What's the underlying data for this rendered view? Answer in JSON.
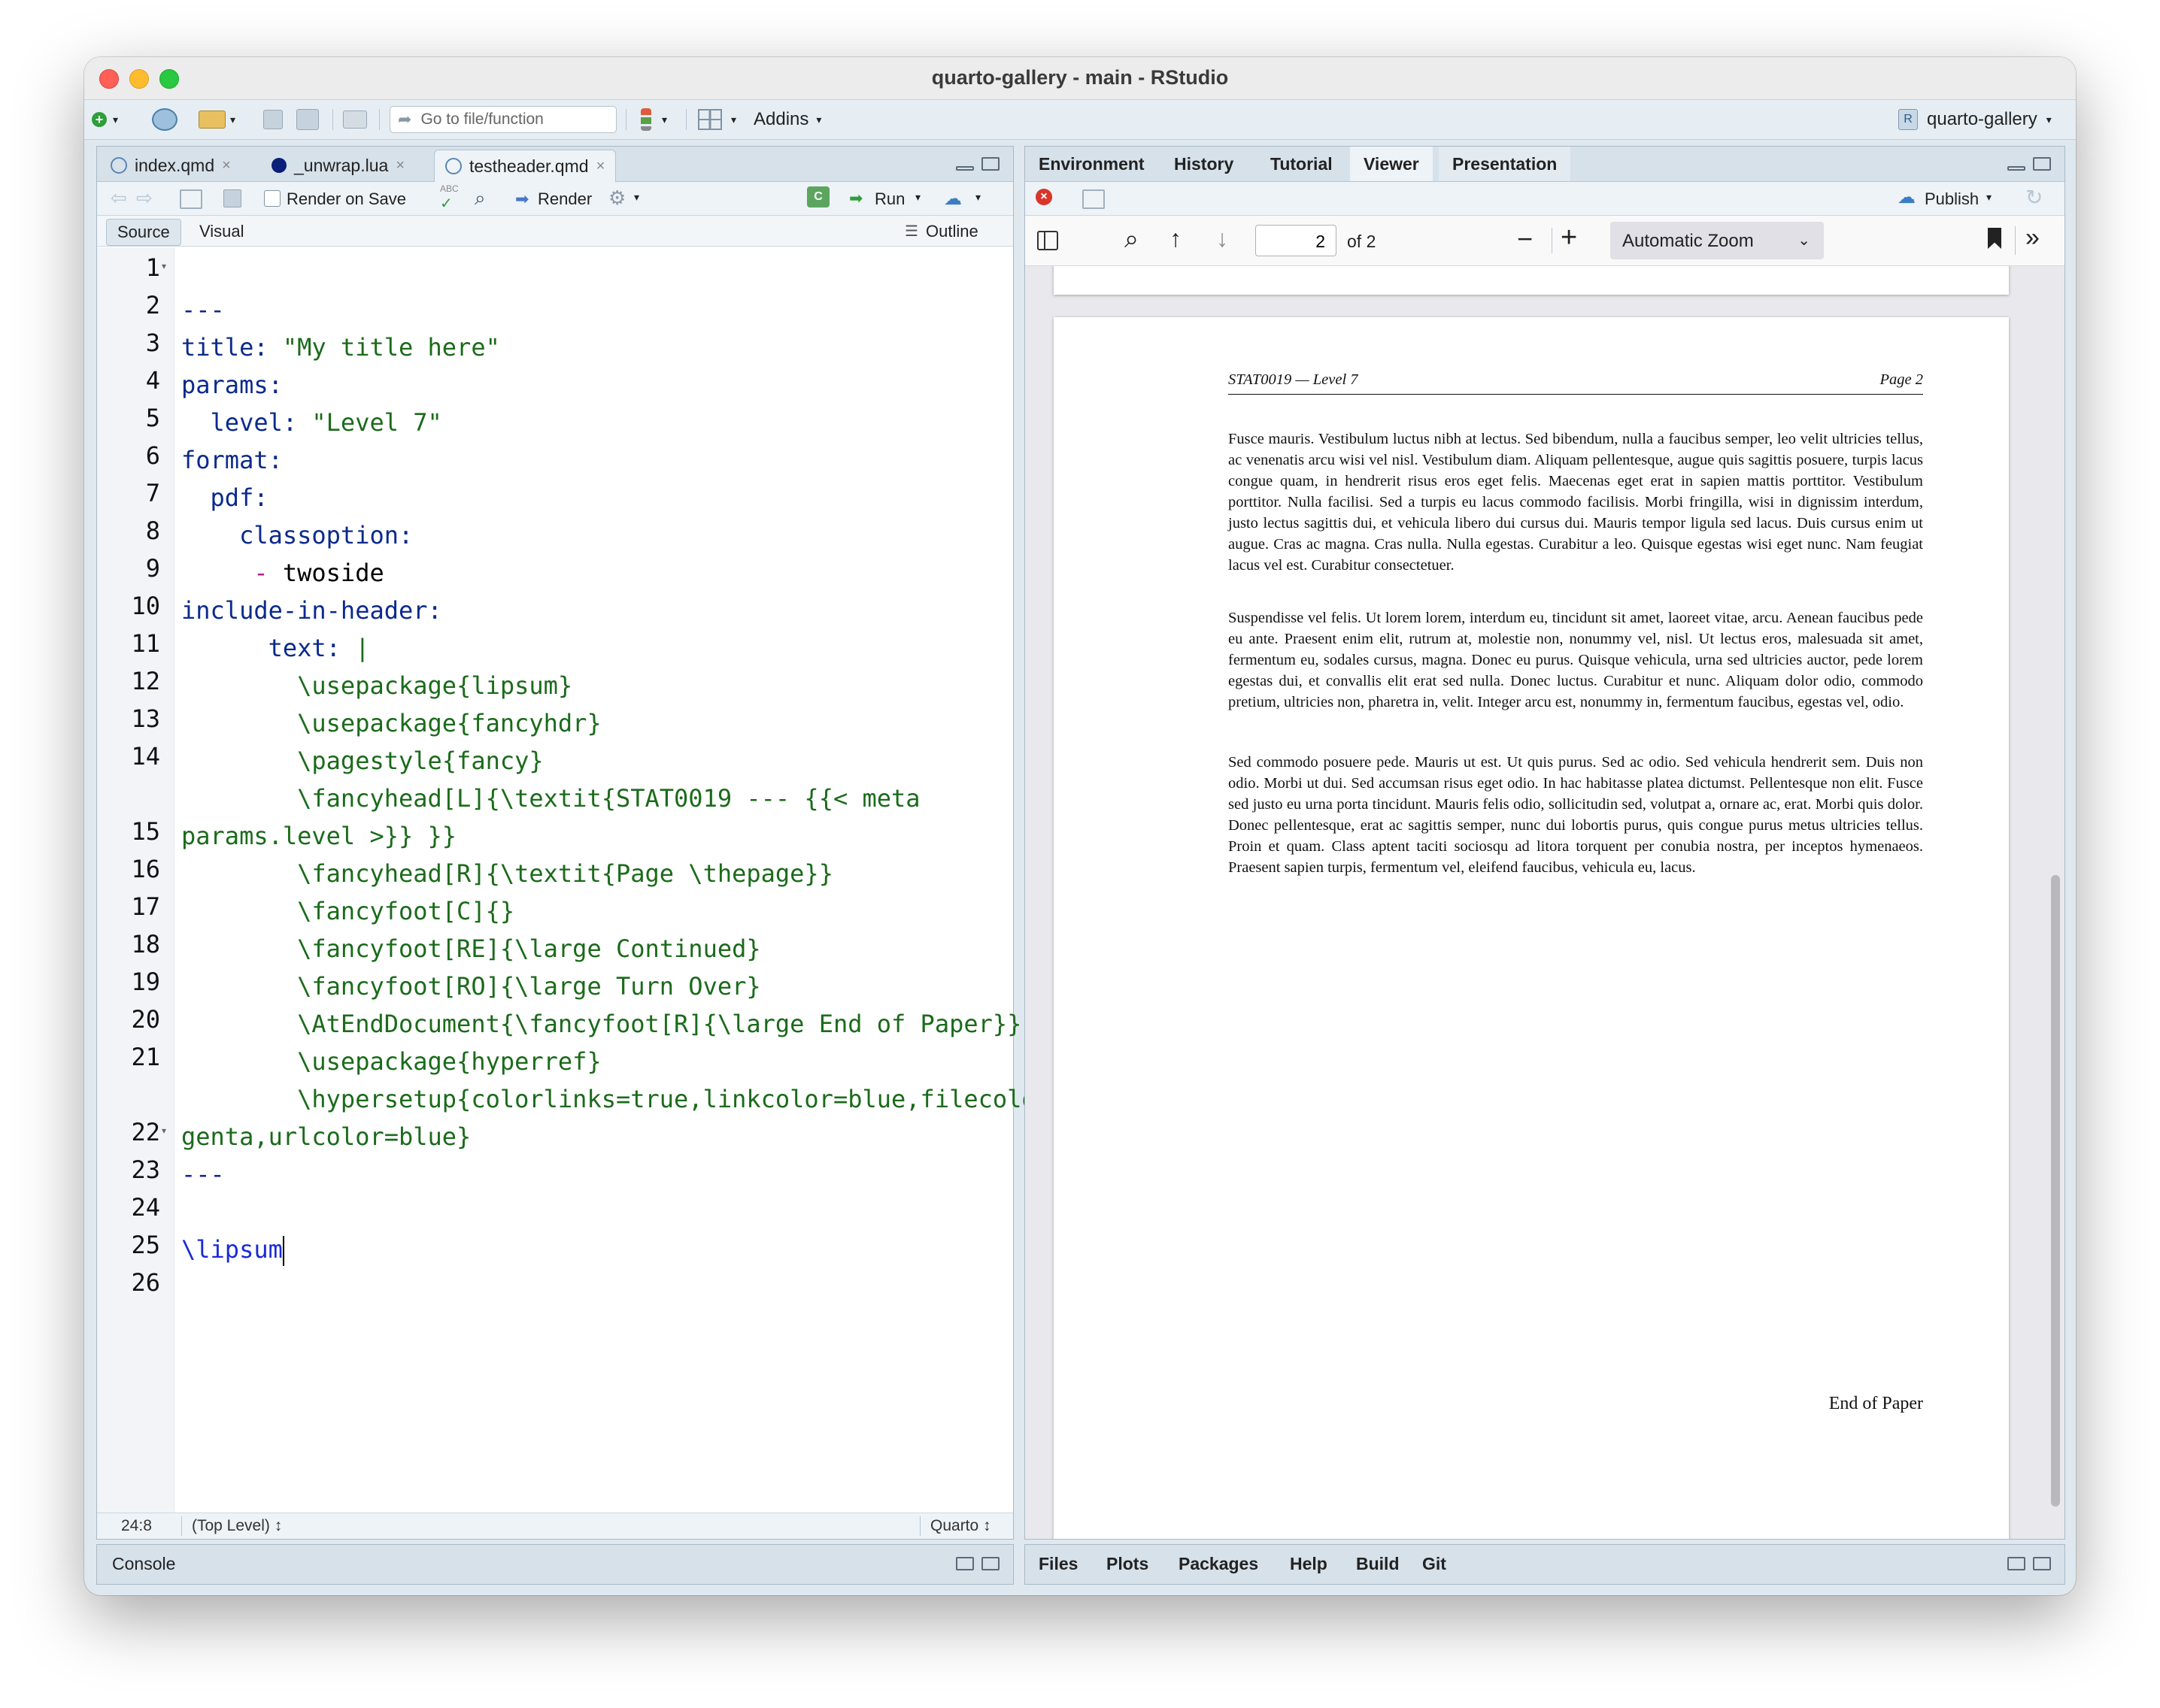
{
  "window": {
    "title": "quarto-gallery - main - RStudio"
  },
  "toolbar": {
    "goto_placeholder": "Go to file/function",
    "addins_label": "Addins",
    "project_label": "quarto-gallery"
  },
  "editor": {
    "tabs": [
      {
        "label": "index.qmd"
      },
      {
        "label": "_unwrap.lua"
      },
      {
        "label": "testheader.qmd"
      }
    ],
    "render_on_save_label": "Render on Save",
    "render_label": "Render",
    "run_label": "Run",
    "source_label": "Source",
    "visual_label": "Visual",
    "outline_label": "Outline",
    "line_numbers": [
      "1",
      "2",
      "3",
      "4",
      "5",
      "6",
      "7",
      "8",
      "9",
      "10",
      "11",
      "12",
      "13",
      "14",
      "15",
      "16",
      "17",
      "18",
      "19",
      "20",
      "21",
      "22",
      "23",
      "24",
      "25",
      "26"
    ],
    "status": {
      "position": "24:8",
      "scope": "(Top Level) ↕",
      "mode": "Quarto ↕"
    }
  },
  "console": {
    "label": "Console"
  },
  "viewer": {
    "tabs": [
      {
        "label": "Environment"
      },
      {
        "label": "History"
      },
      {
        "label": "Tutorial"
      },
      {
        "label": "Viewer"
      },
      {
        "label": "Presentation"
      }
    ],
    "publish_label": "Publish",
    "page_number": "2",
    "page_total": "of 2",
    "zoom_label": "Automatic Zoom",
    "pdf": {
      "header_left": "STAT0019 — Level 7",
      "header_right": "Page 2",
      "paragraphs": [
        "Fusce mauris. Vestibulum luctus nibh at lectus. Sed bibendum, nulla a faucibus semper, leo velit ultricies tellus, ac venenatis arcu wisi vel nisl. Vestibulum diam. Aliquam pellentesque, augue quis sagittis posuere, turpis lacus congue quam, in hendrerit risus eros eget felis. Maecenas eget erat in sapien mattis porttitor. Vestibulum porttitor. Nulla facilisi. Sed a turpis eu lacus commodo facilisis. Morbi fringilla, wisi in dignissim interdum, justo lectus sagittis dui, et vehicula libero dui cursus dui. Mauris tempor ligula sed lacus. Duis cursus enim ut augue. Cras ac magna. Cras nulla. Nulla egestas. Curabitur a leo. Quisque egestas wisi eget nunc. Nam feugiat lacus vel est. Curabitur consectetuer.",
        "Suspendisse vel felis. Ut lorem lorem, interdum eu, tincidunt sit amet, laoreet vitae, arcu. Aenean faucibus pede eu ante. Praesent enim elit, rutrum at, molestie non, nonummy vel, nisl. Ut lectus eros, malesuada sit amet, fermentum eu, sodales cursus, magna. Donec eu purus. Quisque vehicula, urna sed ultricies auctor, pede lorem egestas dui, et convallis elit erat sed nulla. Donec luctus. Curabitur et nunc. Aliquam dolor odio, commodo pretium, ultricies non, pharetra in, velit. Integer arcu est, nonummy in, fermentum faucibus, egestas vel, odio.",
        "Sed commodo posuere pede. Mauris ut est. Ut quis purus. Sed ac odio. Sed vehicula hendrerit sem. Duis non odio. Morbi ut dui. Sed accumsan risus eget odio. In hac habitasse platea dictumst. Pellentesque non elit. Fusce sed justo eu urna porta tincidunt. Mauris felis odio, sollicitudin sed, volutpat a, ornare ac, erat. Morbi quis dolor. Donec pellentesque, erat ac sagittis semper, nunc dui lobortis purus, quis congue purus metus ultricies tellus. Proin et quam. Class aptent taciti sociosqu ad litora torquent per conubia nostra, per inceptos hymenaeos. Praesent sapien turpis, fermentum vel, eleifend faucibus, vehicula eu, lacus."
      ],
      "footer": "End of Paper"
    }
  },
  "bottom_right": {
    "tabs": [
      {
        "label": "Files"
      },
      {
        "label": "Plots"
      },
      {
        "label": "Packages"
      },
      {
        "label": "Help"
      },
      {
        "label": "Build"
      },
      {
        "label": "Git"
      }
    ]
  },
  "colors": {
    "key": "#0b2a8c",
    "string": "#1b6b1b",
    "dash": "#b0218e",
    "command": "#1a2bd6"
  }
}
